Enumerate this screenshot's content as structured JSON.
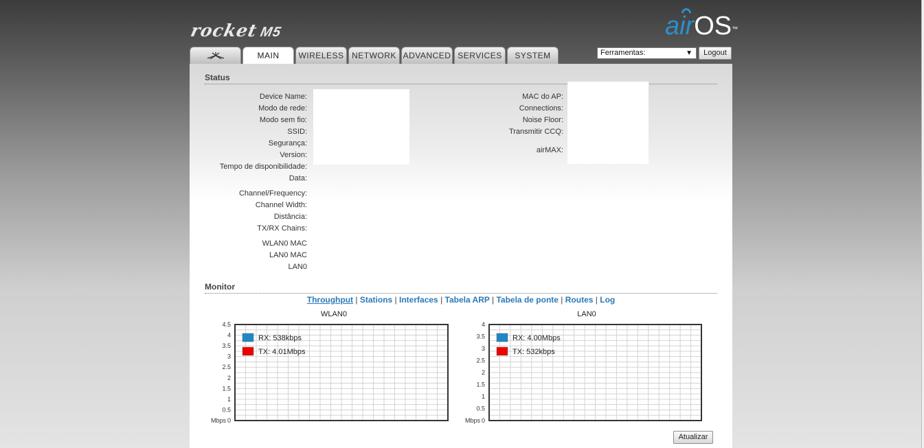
{
  "header": {
    "brand": "rocket",
    "model": "M5",
    "os_logo_air": "air",
    "os_logo_os": "OS",
    "os_logo_tm": "™"
  },
  "tabs": [
    {
      "label": "",
      "icon": "ubiquiti-logo-icon"
    },
    {
      "label": "MAIN",
      "active": true
    },
    {
      "label": "WIRELESS"
    },
    {
      "label": "NETWORK"
    },
    {
      "label": "ADVANCED"
    },
    {
      "label": "SERVICES"
    },
    {
      "label": "SYSTEM"
    }
  ],
  "tools": {
    "select_value": "Ferramentas:",
    "logout_label": "Logout"
  },
  "status": {
    "title": "Status",
    "left_labels": [
      "Device Name:",
      "Modo de rede:",
      "Modo sem fio:",
      "SSID:",
      "Segurança:",
      "Version:",
      "Tempo de disponibilidade:",
      "Data:",
      "Channel/Frequency:",
      "Channel Width:",
      "Distância:",
      "TX/RX Chains:",
      "WLAN0 MAC",
      "LAN0 MAC",
      "LAN0"
    ],
    "right_labels": [
      "MAC do AP:",
      "Connections:",
      "Noise Floor:",
      "Transmitir CCQ:",
      "airMAX:"
    ]
  },
  "monitor": {
    "title": "Monitor",
    "links": [
      "Throughput",
      "Stations",
      "Interfaces",
      "Tabela ARP",
      "Tabela de ponte",
      "Routes",
      "Log"
    ],
    "selected_link": "Throughput",
    "update_label": "Atualizar"
  },
  "colors": {
    "rx": "#1f87c9",
    "tx": "#ee0000",
    "accent_link": "#2a7ab8"
  },
  "chart_data": [
    {
      "type": "line",
      "title": "WLAN0",
      "ylabel": "Mbps",
      "ylim": [
        0,
        4.5
      ],
      "yticks": [
        "0",
        "0.5",
        "1",
        "1.5",
        "2",
        "2.5",
        "3",
        "3.5",
        "4",
        "4.5"
      ],
      "grid": true,
      "legend": "top-left",
      "series": [
        {
          "name": "RX: 538kbps",
          "values": []
        },
        {
          "name": "TX: 4.01Mbps",
          "values": []
        }
      ]
    },
    {
      "type": "line",
      "title": "LAN0",
      "ylabel": "Mbps",
      "ylim": [
        0,
        4
      ],
      "yticks": [
        "0",
        "0.5",
        "1",
        "1.5",
        "2",
        "2.5",
        "3",
        "3.5",
        "4"
      ],
      "grid": true,
      "legend": "top-left",
      "series": [
        {
          "name": "RX: 4.00Mbps",
          "values": []
        },
        {
          "name": "TX: 532kbps",
          "values": []
        }
      ]
    }
  ]
}
